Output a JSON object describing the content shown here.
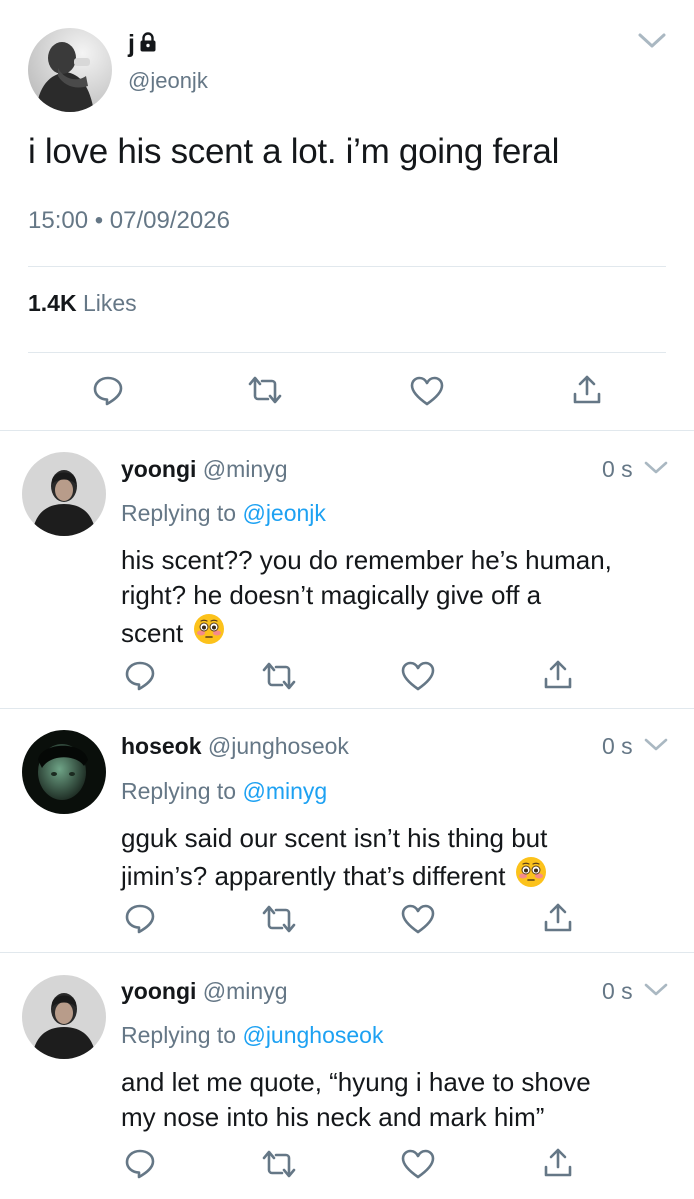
{
  "main_tweet": {
    "author_name": "j",
    "author_handle": "@jeonjk",
    "text": "i love his scent a lot. i’m going feral",
    "timestamp": "15:00 • 07/09/2026",
    "likes_count": "1.4K",
    "likes_label": "Likes",
    "icons": [
      "lock-icon",
      "chevron-down-icon",
      "reply-icon",
      "retweet-icon",
      "like-icon",
      "share-icon"
    ]
  },
  "replies": [
    {
      "name": "yoongi",
      "handle": "@minyg",
      "time": "0 s",
      "replying_label": "Replying to",
      "replying_to": "@jeonjk",
      "text_line1": "his scent?? you do remember he’s human,",
      "text_line2": "right? he doesn’t magically give off a",
      "text_line3": "scent"
    },
    {
      "name": "hoseok",
      "handle": "@junghoseok",
      "time": "0 s",
      "replying_label": "Replying to",
      "replying_to": "@minyg",
      "text_line1": "gguk said our scent isn’t his thing but",
      "text_line2": "jimin’s? apparently that’s different"
    },
    {
      "name": "yoongi",
      "handle": "@minyg",
      "time": "0 s",
      "replying_label": "Replying to",
      "replying_to": "@junghoseok",
      "text_line1": "and let me quote, “hyung i have to shove",
      "text_line2": "my nose into his neck and mark him”"
    }
  ],
  "colors": {
    "text": "#14171a",
    "secondary": "#657786",
    "link": "#1da1f2",
    "divider": "#e1e8ed"
  }
}
